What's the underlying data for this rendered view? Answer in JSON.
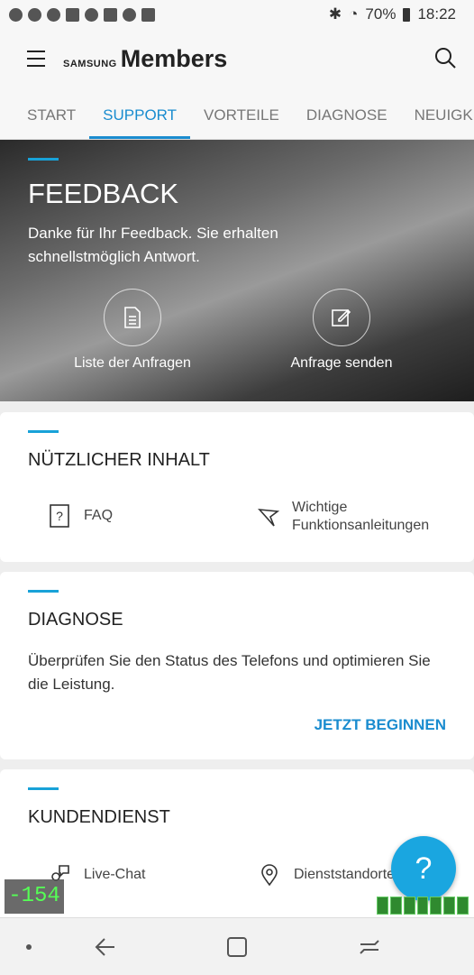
{
  "status": {
    "battery": "70%",
    "time": "18:22"
  },
  "app": {
    "brand_small": "SAMSUNG",
    "brand_large": "Members"
  },
  "tabs": [
    {
      "label": "START"
    },
    {
      "label": "SUPPORT"
    },
    {
      "label": "VORTEILE"
    },
    {
      "label": "DIAGNOSE"
    },
    {
      "label": "NEUIGKE"
    }
  ],
  "feedback": {
    "title": "FEEDBACK",
    "description": "Danke für Ihr Feedback. Sie erhalten schnellstmöglich Antwort.",
    "actions": [
      {
        "label": "Liste der Anfragen"
      },
      {
        "label": "Anfrage senden"
      }
    ]
  },
  "useful": {
    "title": "NÜTZLICHER INHALT",
    "items": [
      {
        "label": "FAQ"
      },
      {
        "label": "Wichtige Funktionsanleitungen"
      }
    ]
  },
  "diagnose": {
    "title": "DIAGNOSE",
    "description": "Überprüfen Sie den Status des Telefons und optimieren Sie die Leistung.",
    "action": "JETZT BEGINNEN"
  },
  "service": {
    "title": "KUNDENDIENST",
    "items": [
      {
        "label": "Live-Chat"
      },
      {
        "label": "Dienststandorte"
      }
    ]
  },
  "fab": {
    "label": "?"
  },
  "overlay": {
    "value": "-154"
  },
  "colors": {
    "accent": "#1a8ccf",
    "bar": "#18a2d8"
  }
}
